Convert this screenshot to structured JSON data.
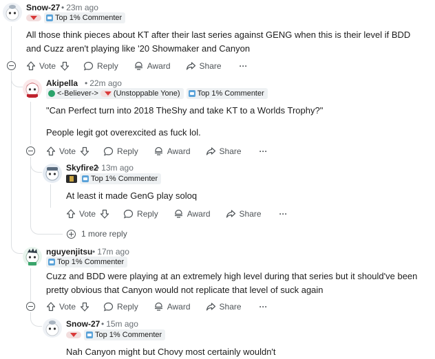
{
  "action_labels": {
    "vote": "Vote",
    "reply": "Reply",
    "award": "Award",
    "share": "Share",
    "more": "···"
  },
  "colors": {
    "accent_red": "#d93a3a",
    "flair_blue": "#5ba3d9",
    "meta_gray": "#6a7075",
    "thread_line": "#dcdfe2"
  },
  "comments": {
    "c1": {
      "username": "Snow-27",
      "time": "23m ago",
      "flair": "Top 1% Commenter",
      "text": "All those think pieces about KT after their last series against GENG when this is their level if BDD and Cuzz aren't playing like '20 Showmaker and Canyon"
    },
    "c2": {
      "username": "Akipella",
      "time": "22m ago",
      "user_flair_left": "<-Believer->",
      "user_flair_right": "(Unstoppable Yone)",
      "flair": "Top 1% Commenter",
      "text1": "\"Can Perfect turn into 2018 TheShy and take KT to a Worlds Trophy?\"",
      "text2": "People legit got overexcited as fuck lol."
    },
    "c3": {
      "username": "Skyfire2",
      "time": "13m ago",
      "flair": "Top 1% Commenter",
      "text": "At least it made GenG play soloq",
      "more_replies": "1 more reply"
    },
    "c4": {
      "username": "nguyenjitsu",
      "time": "17m ago",
      "flair": "Top 1% Commenter",
      "text": "Cuzz and BDD were playing at an extremely high level during that series but it should've been pretty obvious that Canyon would not replicate that level of suck again"
    },
    "c5": {
      "username": "Snow-27",
      "time": "15m ago",
      "flair": "Top 1% Commenter",
      "text": "Nah Canyon might but Chovy most certainly wouldn't"
    }
  }
}
